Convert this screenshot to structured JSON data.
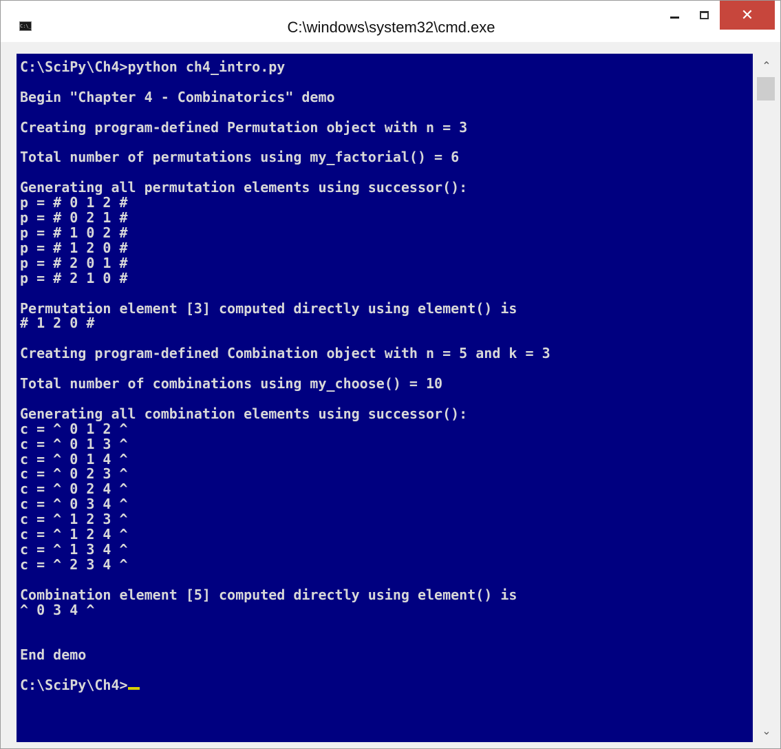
{
  "window": {
    "title": "C:\\windows\\system32\\cmd.exe",
    "icon_label": "C:\\_",
    "controls": {
      "close_label": "✕"
    }
  },
  "console": {
    "lines": [
      "C:\\SciPy\\Ch4>python ch4_intro.py",
      "",
      "Begin \"Chapter 4 - Combinatorics\" demo",
      "",
      "Creating program-defined Permutation object with n = 3",
      "",
      "Total number of permutations using my_factorial() = 6",
      "",
      "Generating all permutation elements using successor():",
      "p = # 0 1 2 #",
      "p = # 0 2 1 #",
      "p = # 1 0 2 #",
      "p = # 1 2 0 #",
      "p = # 2 0 1 #",
      "p = # 2 1 0 #",
      "",
      "Permutation element [3] computed directly using element() is",
      "# 1 2 0 #",
      "",
      "Creating program-defined Combination object with n = 5 and k = 3",
      "",
      "Total number of combinations using my_choose() = 10",
      "",
      "Generating all combination elements using successor():",
      "c = ^ 0 1 2 ^",
      "c = ^ 0 1 3 ^",
      "c = ^ 0 1 4 ^",
      "c = ^ 0 2 3 ^",
      "c = ^ 0 2 4 ^",
      "c = ^ 0 3 4 ^",
      "c = ^ 1 2 3 ^",
      "c = ^ 1 2 4 ^",
      "c = ^ 1 3 4 ^",
      "c = ^ 2 3 4 ^",
      "",
      "Combination element [5] computed directly using element() is",
      "^ 0 3 4 ^",
      "",
      "",
      "End demo",
      "",
      "C:\\SciPy\\Ch4>"
    ],
    "colors": {
      "background": "#000080",
      "text": "#d8d8d8",
      "cursor": "#d8d000"
    }
  },
  "scrollbar": {
    "up_glyph": "⌃",
    "down_glyph": "⌄"
  }
}
